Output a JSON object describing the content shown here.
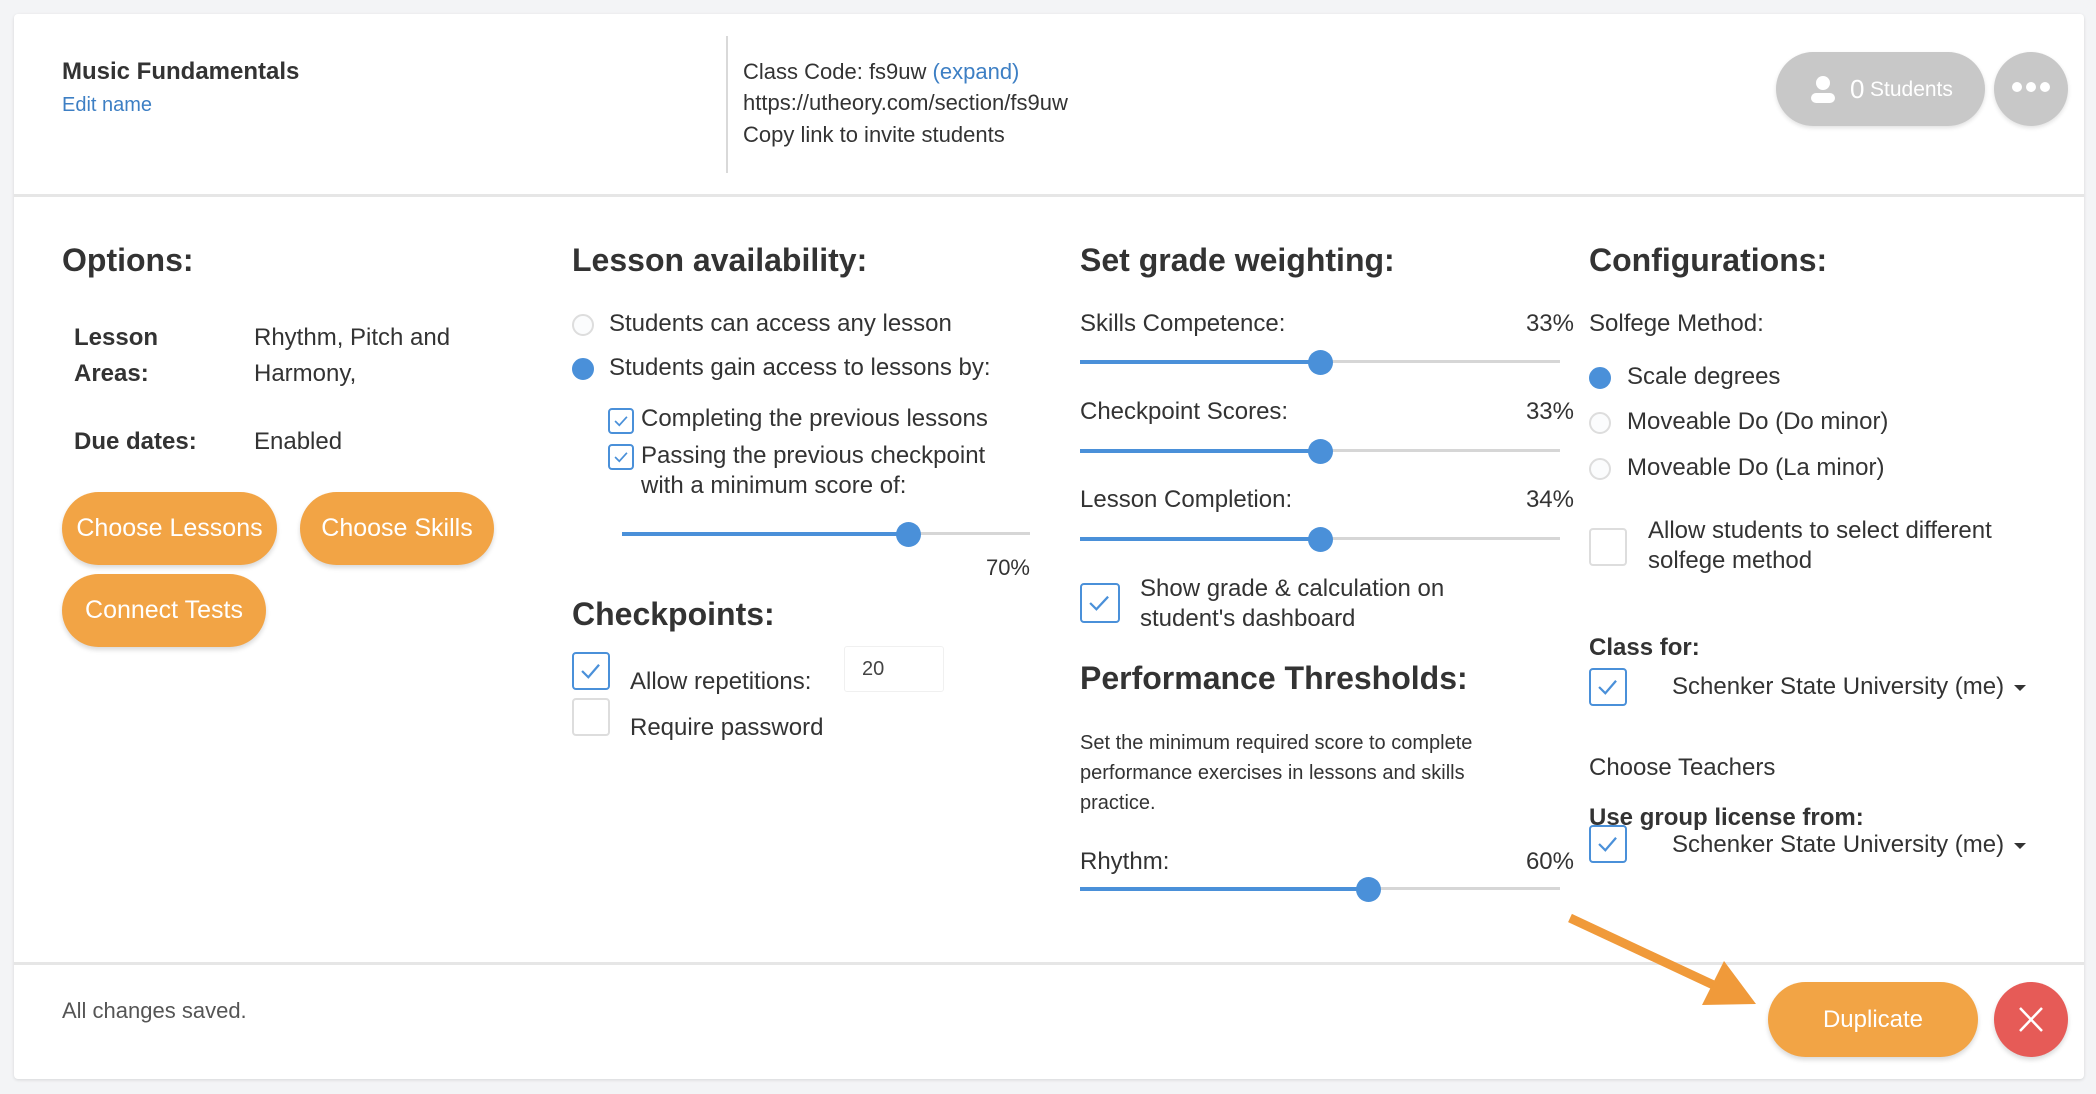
{
  "header": {
    "class_name": "Music Fundamentals",
    "edit_name_label": "Edit name",
    "class_code_label": "Class Code: fs9uw",
    "expand_label": "(expand)",
    "class_url": "https://utheory.com/section/fs9uw",
    "copy_link_label": "Copy link to invite students",
    "students_count": "0",
    "students_label": "Students",
    "more_icon": "ellipsis-icon",
    "user_icon": "person-icon"
  },
  "options": {
    "heading": "Options:",
    "rows": [
      {
        "label_line1": "Lesson",
        "label_line2": "Areas:",
        "value_line1": "Rhythm, Pitch and",
        "value_line2": "Harmony,"
      },
      {
        "label": "Due dates:",
        "value": "Enabled"
      }
    ],
    "buttons": {
      "choose_lessons": "Choose Lessons",
      "choose_skills": "Choose Skills",
      "connect_tests": "Connect Tests"
    }
  },
  "lesson_availability": {
    "heading": "Lesson availability:",
    "options": [
      {
        "label": "Students can access any lesson",
        "selected": false
      },
      {
        "label": "Students gain access to lessons by:",
        "selected": true
      }
    ],
    "conditions": [
      {
        "label": "Completing the previous lessons",
        "checked": true
      },
      {
        "label_line1": "Passing the previous checkpoint",
        "label_line2": "with a minimum score of:",
        "checked": true
      }
    ],
    "min_score": {
      "value": 70,
      "display": "70%"
    }
  },
  "checkpoints": {
    "heading": "Checkpoints:",
    "allow_repetitions": {
      "label": "Allow repetitions:",
      "checked": true,
      "value": "20"
    },
    "require_password": {
      "label": "Require password",
      "checked": false
    }
  },
  "grade_weighting": {
    "heading": "Set grade weighting:",
    "items": [
      {
        "label": "Skills Competence:",
        "display": "33%",
        "fill_fraction": 0.5
      },
      {
        "label": "Checkpoint Scores:",
        "display": "33%",
        "fill_fraction": 0.5
      },
      {
        "label": "Lesson Completion:",
        "display": "34%",
        "fill_fraction": 0.5
      }
    ],
    "show_grade": {
      "label_line1": "Show grade & calculation on",
      "label_line2": "student's dashboard",
      "checked": true
    }
  },
  "performance_thresholds": {
    "heading": "Performance Thresholds:",
    "description_lines": [
      "Set the minimum required score to complete",
      "performance exercises in lessons and skills",
      "practice."
    ],
    "rhythm": {
      "label": "Rhythm:",
      "display": "60%",
      "fill_fraction": 0.6
    }
  },
  "configurations": {
    "heading": "Configurations:",
    "solfege_label": "Solfege Method:",
    "solfege_options": [
      {
        "label": "Scale degrees",
        "selected": true
      },
      {
        "label": "Moveable Do (Do minor)",
        "selected": false
      },
      {
        "label": "Moveable Do (La minor)",
        "selected": false
      }
    ],
    "allow_select": {
      "label_line1": "Allow students to select different",
      "label_line2": "solfege method",
      "checked": false
    },
    "class_for": {
      "label": "Class for:",
      "checked": true,
      "value": "Schenker State University (me)"
    },
    "choose_teachers_label": "Choose Teachers",
    "group_license": {
      "label": "Use group license from:",
      "checked": true,
      "value": "Schenker State University (me)"
    }
  },
  "footer": {
    "status": "All changes saved.",
    "duplicate_label": "Duplicate",
    "close_icon": "close-icon"
  },
  "colors": {
    "accent_orange": "#f2a445",
    "accent_blue": "#4a90d9",
    "danger_red": "#e65b57",
    "link_blue": "#3d7fc4",
    "pill_gray": "#c8c8c8"
  }
}
